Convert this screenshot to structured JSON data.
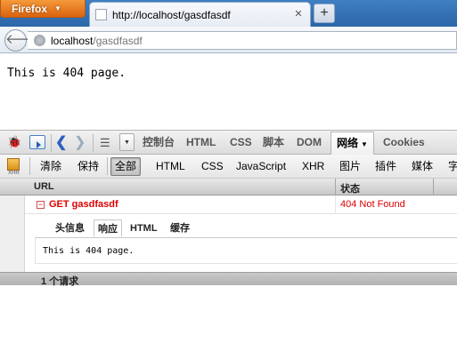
{
  "browser": {
    "menu_button_label": "Firefox",
    "tab_title": "http://localhost/gasdfasdf",
    "new_tab_label": "+",
    "tab_close_label": "✕",
    "url_host": "localhost",
    "url_path": "/gasdfasdf"
  },
  "page": {
    "body_text": "This is 404 page."
  },
  "firebug": {
    "panel_tabs": [
      "控制台",
      "HTML",
      "CSS",
      "脚本",
      "DOM",
      "网络",
      "Cookies"
    ],
    "active_panel": "网络",
    "net_toolbar": {
      "xhr_icon_label": "XHR",
      "clear": "清除",
      "persist": "保持",
      "filters": [
        "全部",
        "HTML",
        "CSS",
        "JavaScript",
        "XHR",
        "图片",
        "插件",
        "媒体",
        "字"
      ],
      "selected_filter": "全部"
    },
    "columns": {
      "url": "URL",
      "status": "状态"
    },
    "request": {
      "toggle": "−",
      "label": "GET gasdfasdf",
      "status": "404 Not Found",
      "status_color": "#dd0000"
    },
    "detail_tabs": [
      "头信息",
      "响应",
      "HTML",
      "缓存"
    ],
    "active_detail_tab": "响应",
    "response_text": "This is 404 page.",
    "footer": "1 个请求"
  }
}
